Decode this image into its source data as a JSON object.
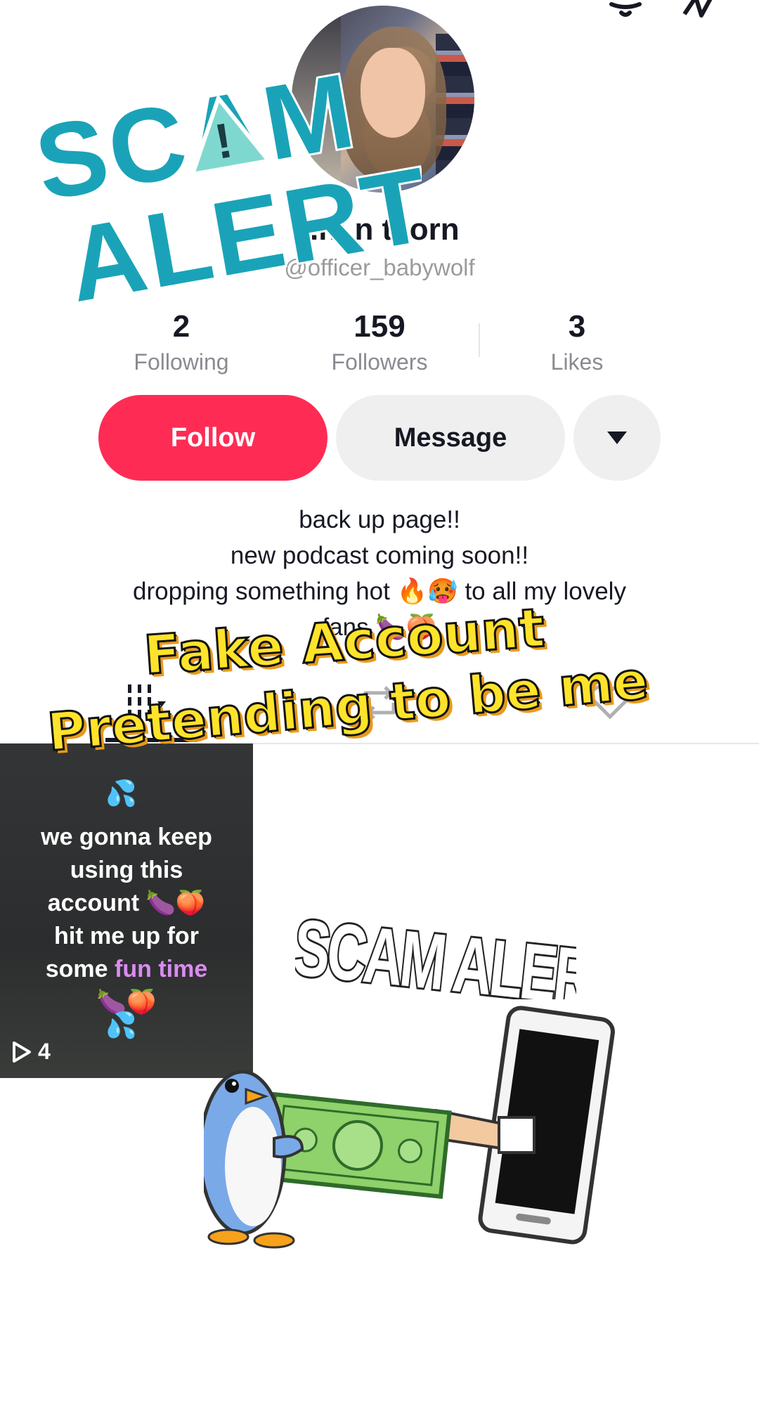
{
  "profile": {
    "display_name": "·.hı n tl orn",
    "handle": "@officer_babywolf"
  },
  "stats": [
    {
      "value": "2",
      "label": "Following"
    },
    {
      "value": "159",
      "label": "Followers"
    },
    {
      "value": "3",
      "label": "Likes"
    }
  ],
  "actions": {
    "follow_label": "Follow",
    "message_label": "Message"
  },
  "bio": {
    "line1": "back up page!!",
    "line2": "new podcast coming soon!!",
    "line3": "dropping something hot 🔥🥵 to all my lovely",
    "line4": "fans 🍆🍑"
  },
  "video": {
    "caption_line1": "we gonna keep",
    "caption_line2": "using this",
    "caption_line3": "account 🍆🍑",
    "caption_line4": "hit me up for",
    "caption_line5_a": "some ",
    "caption_line5_b": "fun time",
    "caption_line6": "🍆🍑",
    "view_count": "4"
  },
  "overlays": {
    "scam_alert_top_line1": "SCAM",
    "scam_alert_top_line2": "ALERT",
    "fake_account_line1": "Fake Account",
    "fake_account_line2": "Pretending to be me",
    "scam_alert_sticker": "SCAM ALERT"
  },
  "colors": {
    "follow_button": "#fe2c55",
    "scam_logo_blue": "#1aa3b8",
    "scam_logo_triangle": "#7fd8cf",
    "overlay_yellow": "#ffe32a",
    "pink_text": "#d98cf0"
  }
}
